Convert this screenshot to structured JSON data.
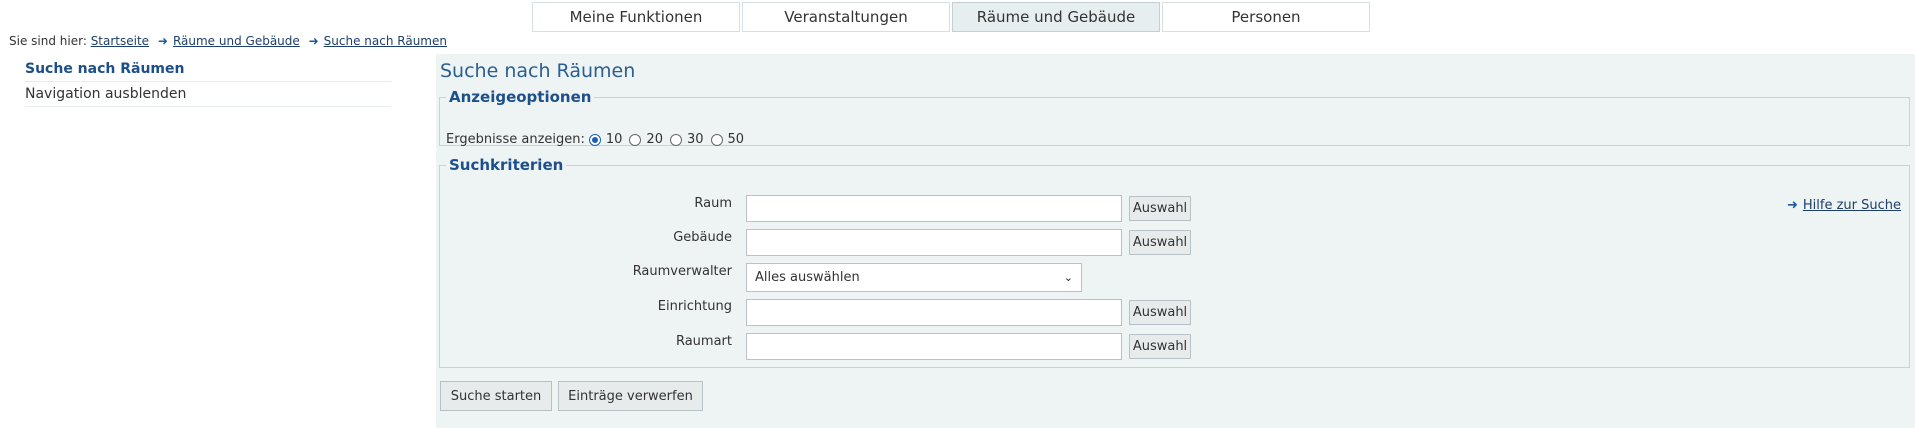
{
  "topnav": {
    "tabs": [
      {
        "label": "Meine Funktionen"
      },
      {
        "label": "Veranstaltungen"
      },
      {
        "label": "Räume und Gebäude"
      },
      {
        "label": "Personen"
      }
    ]
  },
  "breadcrumb": {
    "prefix": "Sie sind hier:",
    "items": [
      "Startseite",
      "Räume und Gebäude",
      "Suche nach Räumen"
    ]
  },
  "sidebar": {
    "items": [
      {
        "label": "Suche nach Räumen"
      },
      {
        "label": "Navigation ausblenden"
      }
    ]
  },
  "main": {
    "title": "Suche nach Räumen",
    "display_options": {
      "legend": "Anzeigeoptionen",
      "label": "Ergebnisse anzeigen:",
      "options": [
        "10",
        "20",
        "30",
        "50"
      ],
      "selected": "10"
    },
    "criteria": {
      "legend": "Suchkriterien",
      "help": "Hilfe zur Suche",
      "select_button": "Auswahl",
      "fields": [
        {
          "label": "Raum",
          "value": "",
          "placeholder": ""
        },
        {
          "label": "Gebäude",
          "value": "",
          "placeholder": ""
        },
        {
          "label": "Raumverwalter",
          "value": "Alles auswählen"
        },
        {
          "label": "Einrichtung",
          "value": "",
          "placeholder": ""
        },
        {
          "label": "Raumart",
          "value": "",
          "placeholder": ""
        }
      ]
    },
    "buttons": {
      "start": "Suche starten",
      "reset": "Einträge verwerfen"
    }
  },
  "colors": {
    "accent": "#1d4f8a",
    "panel_bg": "#eef3f4",
    "border": "#c8d3d7"
  }
}
